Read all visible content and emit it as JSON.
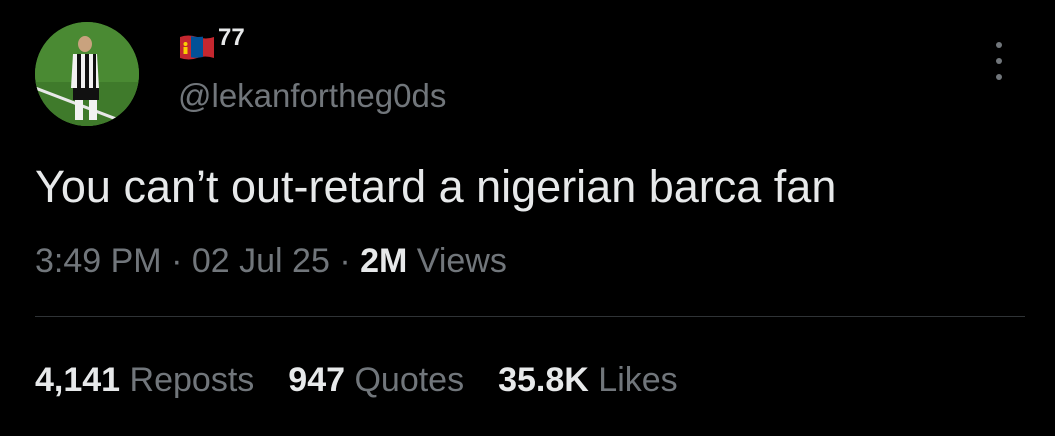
{
  "author": {
    "flag_icon": "mongolia-flag-icon",
    "display_name": "77",
    "handle": "@lekanfortheg0ds"
  },
  "tweet": {
    "text": "You can’t out-retard a nigerian barca fan",
    "time": "3:49 PM",
    "date": "02 Jul 25",
    "separator": "·",
    "views_count": "2M",
    "views_label": "Views"
  },
  "stats": {
    "reposts_count": "4,141",
    "reposts_label": "Reposts",
    "quotes_count": "947",
    "quotes_label": "Quotes",
    "likes_count": "35.8K",
    "likes_label": "Likes"
  },
  "colors": {
    "background": "#000000",
    "primary_text": "#e7e9ea",
    "secondary_text": "#71767b",
    "divider": "#2f3336"
  }
}
